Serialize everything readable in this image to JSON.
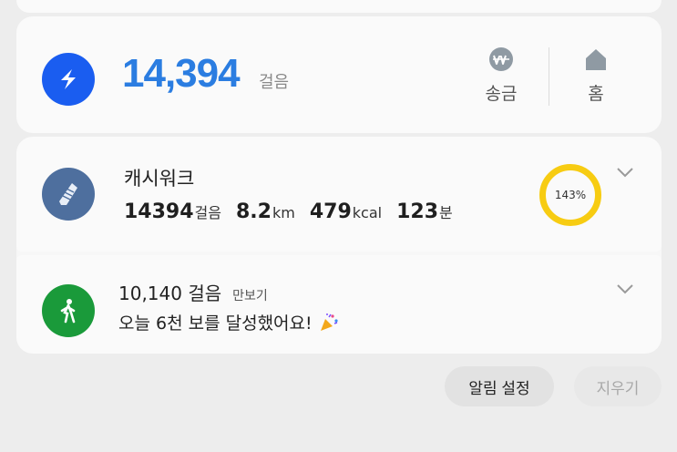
{
  "steps_card": {
    "count": "14,394",
    "unit": "걸음",
    "actions": [
      {
        "label": "송금",
        "icon": "won-coin-icon"
      },
      {
        "label": "홈",
        "icon": "home-icon"
      }
    ],
    "logo_icon": "app-logo-icon",
    "brand_color": "#1a5df0",
    "count_color": "#2b7de1"
  },
  "notifications": [
    {
      "app": "캐시워크",
      "icon": "shoe-icon",
      "stats": [
        {
          "value": "14394",
          "unit": "걸음"
        },
        {
          "value": "8.2",
          "unit": "km"
        },
        {
          "value": "479",
          "unit": "kcal"
        },
        {
          "value": "123",
          "unit": "분"
        }
      ],
      "progress_label": "143%",
      "progress_percent": 143,
      "ring_color": "#f7cc12"
    },
    {
      "steps": "10,140 걸음",
      "source": "만보기",
      "message": "오늘 6천 보를 달성했어요!",
      "icon": "walking-person-icon",
      "emoji_icon": "party-popper-icon",
      "icon_color": "#1a9a3a"
    }
  ],
  "buttons": {
    "settings": "알림 설정",
    "clear": "지우기"
  }
}
